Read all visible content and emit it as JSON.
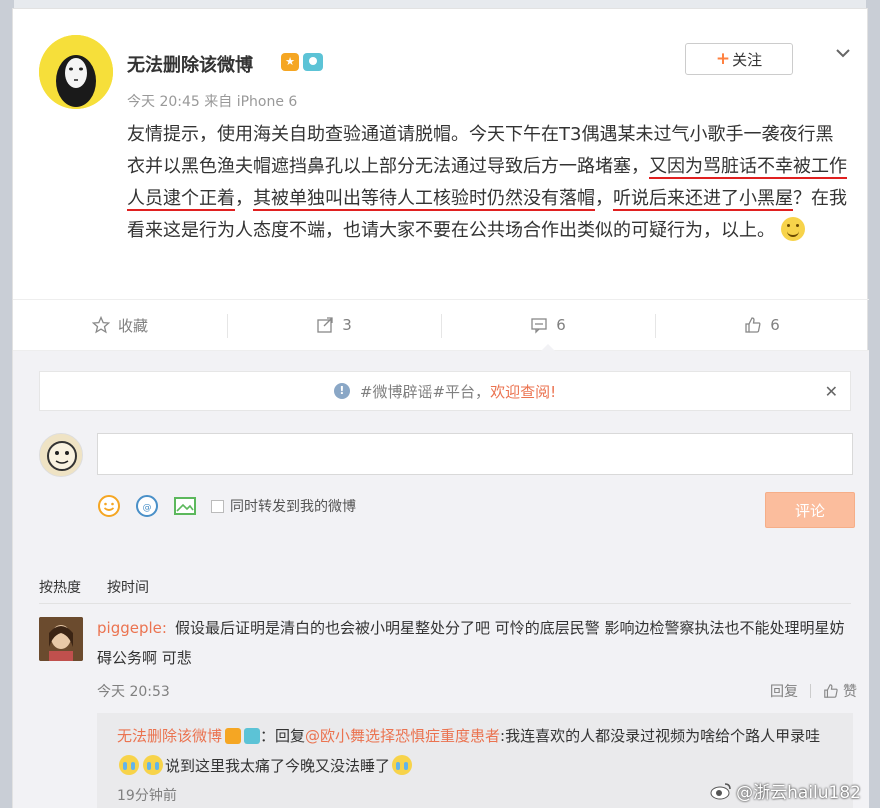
{
  "post": {
    "username": "无法删除该微博",
    "vip_badge": "★",
    "meta": "今天 20:45 来自 iPhone 6",
    "follow_label": "关注",
    "follow_plus": "+",
    "text_1": "友情提示，使用海关自助查验通道请脱帽。今天下午在T3偶遇某未过气小歌手一袭夜行黑衣并以黑色渔夫帽遮挡鼻孔以上部分无法通过导致后方一路堵塞，",
    "text_2": "又因为骂脏话不幸被工作人员逮个正着",
    "text_3": "，",
    "text_4": "其被单独叫出等待人工核验时仍然没有落帽",
    "text_5": "，",
    "text_6": "听说后来还进了小黑屋",
    "text_7": "？在我看来这是行为人态度不端，也请大家不要在公共场合作出类似的可疑行为，以上。"
  },
  "actions": {
    "favorite": "收藏",
    "repost": "3",
    "comment": "6",
    "like": "6"
  },
  "notice": {
    "prefix": "#微博辟谣#平台，",
    "link": "欢迎查阅!",
    "close": "✕"
  },
  "composer": {
    "placeholder": "",
    "repost_label": "同时转发到我的微博",
    "submit_label": "评论"
  },
  "sort_tabs": [
    "按热度",
    "按时间"
  ],
  "comment": {
    "nick": "piggeple:",
    "text": "假设最后证明是清白的也会被小明星整处分了吧 可怜的底层民警 影响边检警察执法也不能处理明星妨碍公务啊 可悲",
    "time": "今天 20:53",
    "reply_label": "回复",
    "like_label": "赞"
  },
  "reply": {
    "nick": "无法删除该微博",
    "prefix": "：回复",
    "mention": "@欧小舞选择恐惧症重度患者",
    "text_1": ":我连喜欢的人都没录过视频为啥给个路人甲录哇",
    "text_2": "说到这里我太痛了今晚又没法睡了",
    "time": "19分钟前"
  },
  "watermark": "@浙云hailu182"
}
